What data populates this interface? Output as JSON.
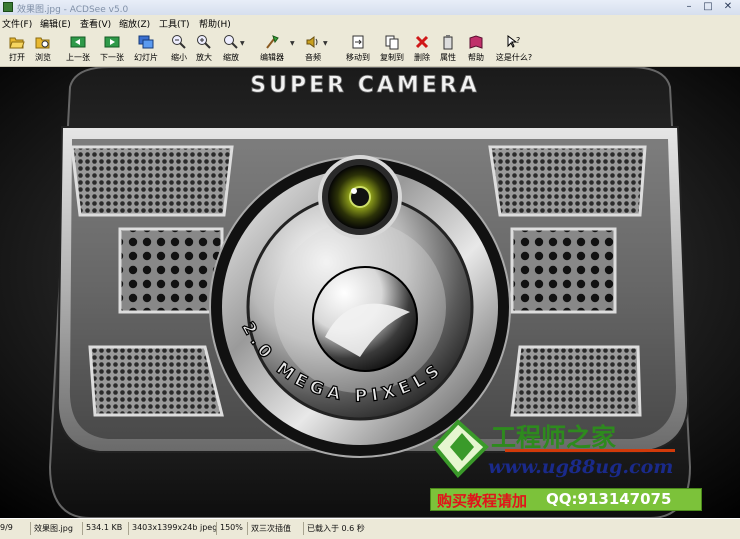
{
  "window": {
    "title": "效果图.jpg - ACDSee v5.0"
  },
  "menu": [
    "文件(F)",
    "编辑(E)",
    "查看(V)",
    "缩放(Z)",
    "工具(T)",
    "帮助(H)"
  ],
  "toolbar": {
    "open": "打开",
    "browse": "浏览",
    "prev": "上一张",
    "next": "下一张",
    "slideshow": "幻灯片",
    "zoom_out": "缩小",
    "zoom_in": "放大",
    "zoom": "缩放",
    "editor": "编辑器",
    "audio": "音频",
    "move_to": "移动到",
    "copy_to": "复制到",
    "delete": "删除",
    "properties": "属性",
    "help": "帮助",
    "whats_this": "这是什么?"
  },
  "image": {
    "brand": "SUPER CAMERA",
    "ring_text": "2.0 MEGA PIXELS"
  },
  "watermark": {
    "site_name": "工程师之家",
    "url": "www.ug88ug.com",
    "promo": "购买教程请加",
    "qq": "QQ:913147075"
  },
  "status": {
    "index": "9/9",
    "filename": "效果图.jpg",
    "filesize": "534.1 KB",
    "dimensions": "3403x1399x24b jpeg",
    "zoom": "150%",
    "filter": "双三次插值",
    "load_time": "已载入于 0.6 秒"
  },
  "colors": {
    "chrome": "#ece9d8",
    "watermark_green": "#2e8a1e",
    "watermark_blue": "#1a2a8a",
    "promo_bg": "#7cc23a",
    "promo_text": "#e0151b"
  }
}
